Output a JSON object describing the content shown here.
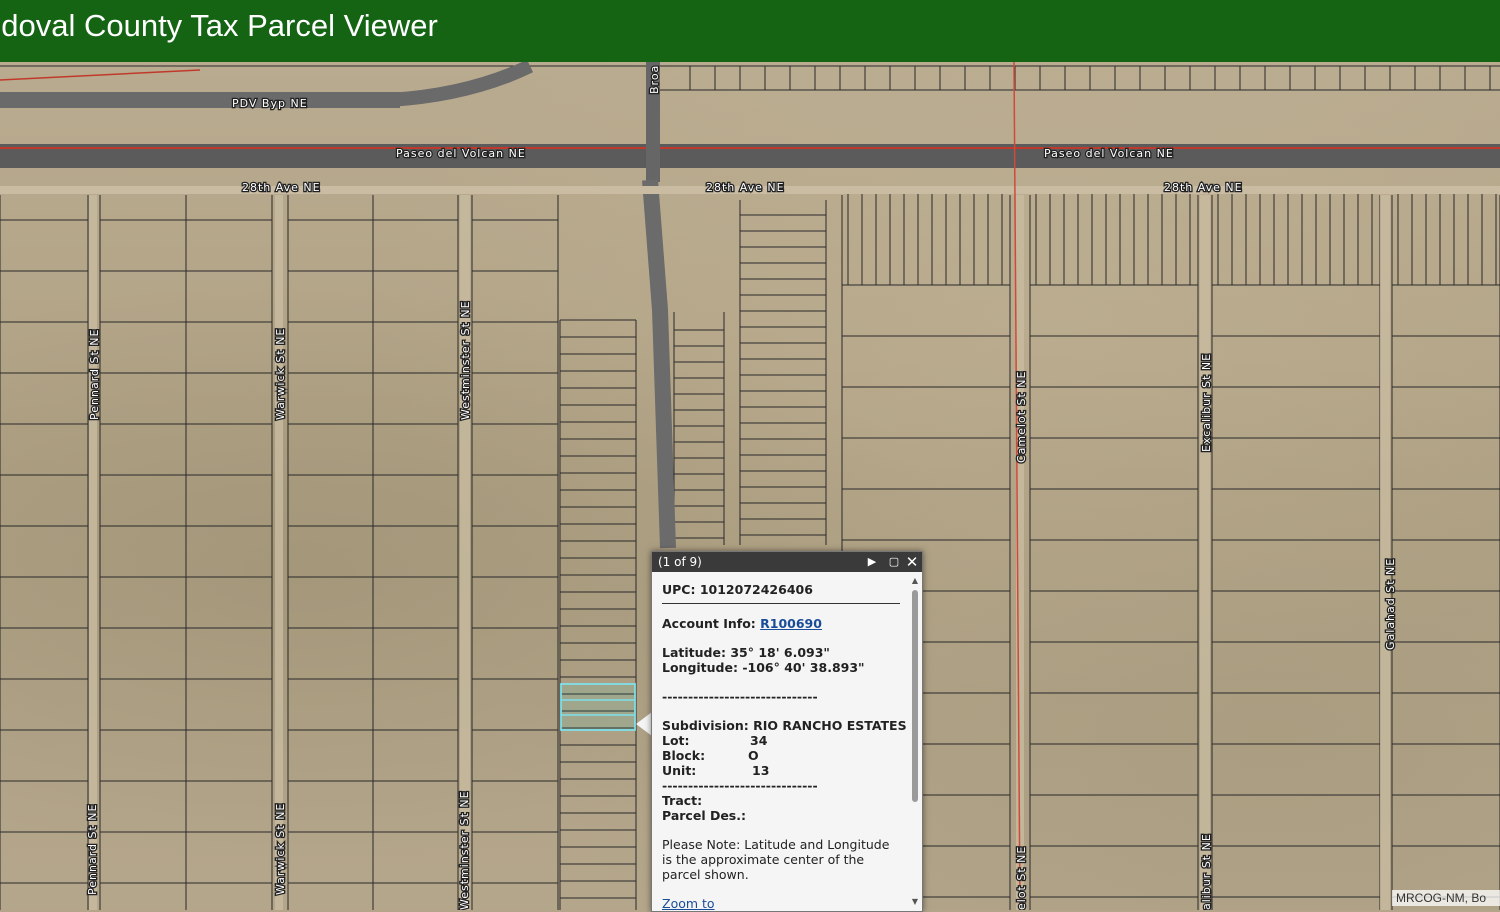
{
  "header": {
    "title": "ndoval County Tax Parcel Viewer"
  },
  "map": {
    "road_labels": {
      "pdv_byp": "PDV Byp NE",
      "paseo_west": "Paseo del Volcan NE",
      "paseo_east": "Paseo del Volcan NE",
      "ave28_west": "28th Ave NE",
      "ave28_mid": "28th Ave NE",
      "ave28_east": "28th Ave NE",
      "broad": "Broa",
      "pennard_top": "Pennard St NE",
      "pennard_bottom": "Pennard St NE",
      "warwick_top": "Warwick St NE",
      "warwick_bottom": "Warwick St NE",
      "westminster_top": "Westminster St NE",
      "westminster_bottom": "Westminster St NE",
      "camelot_top": "Camelot St NE",
      "camelot_bottom": "elot St NE",
      "excalibur_top": "Excalibur St NE",
      "excalibur_bottom": "alibur St NE",
      "galahad": "Galahad St NE"
    },
    "attribution": "MRCOG-NM, Bo"
  },
  "popup": {
    "count": "(1 of 9)",
    "upc_label": "UPC:",
    "upc_value": "1012072426406",
    "account_label": "Account Info:",
    "account_value": "R100690",
    "lat_label": "Latitude:",
    "lat_value": "35° 18' 6.093\"",
    "lon_label": "Longitude:",
    "lon_value": "-106° 40' 38.893\"",
    "separator": "------------------------------",
    "subdivision_label": "Subdivision:",
    "subdivision_value": "RIO RANCHO ESTATES",
    "lot_label": "Lot:",
    "lot_value": "34",
    "block_label": "Block:",
    "block_value": "O",
    "unit_label": "Unit:",
    "unit_value": "13",
    "tract_label": "Tract:",
    "parcel_label": "Parcel Des.:",
    "note": "Please Note: Latitude and Longitude is the approximate center of the parcel shown.",
    "zoom_label": "Zoom to"
  }
}
